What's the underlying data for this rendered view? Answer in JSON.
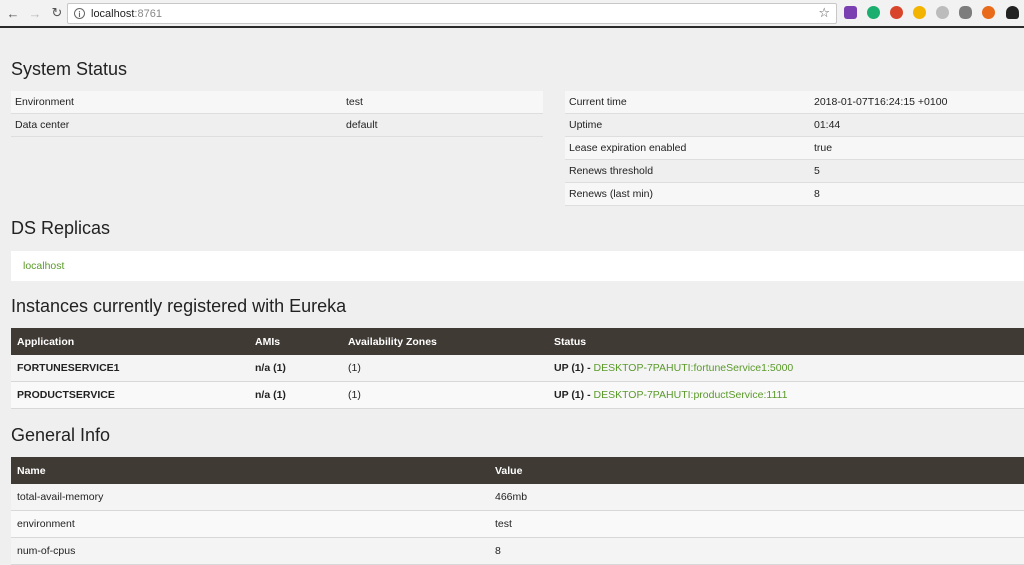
{
  "browser": {
    "back_icon": "←",
    "forward_icon": "→",
    "reload_icon": "↻",
    "url_host": "localhost",
    "url_port": ":8761",
    "star_icon": "☆"
  },
  "system_status": {
    "title": "System Status",
    "left": [
      {
        "label": "Environment",
        "value": "test"
      },
      {
        "label": "Data center",
        "value": "default"
      }
    ],
    "right": [
      {
        "label": "Current time",
        "value": "2018-01-07T16:24:15 +0100"
      },
      {
        "label": "Uptime",
        "value": "01:44"
      },
      {
        "label": "Lease expiration enabled",
        "value": "true"
      },
      {
        "label": "Renews threshold",
        "value": "5"
      },
      {
        "label": "Renews (last min)",
        "value": "8"
      }
    ]
  },
  "ds_replicas": {
    "title": "DS Replicas",
    "link": "localhost"
  },
  "instances": {
    "title": "Instances currently registered with Eureka",
    "headers": [
      "Application",
      "AMIs",
      "Availability Zones",
      "Status"
    ],
    "rows": [
      {
        "application": "FORTUNESERVICE1",
        "amis": "n/a (1)",
        "zones": "(1)",
        "status_prefix": "UP (1) - ",
        "status_link": "DESKTOP-7PAHUTI:fortuneService1:5000"
      },
      {
        "application": "PRODUCTSERVICE",
        "amis": "n/a (1)",
        "zones": "(1)",
        "status_prefix": "UP (1) - ",
        "status_link": "DESKTOP-7PAHUTI:productService:1111"
      }
    ]
  },
  "general_info": {
    "title": "General Info",
    "headers": [
      "Name",
      "Value"
    ],
    "rows": [
      {
        "name": "total-avail-memory",
        "value": "466mb"
      },
      {
        "name": "environment",
        "value": "test"
      },
      {
        "name": "num-of-cpus",
        "value": "8"
      }
    ]
  },
  "colors": {
    "header_bg": "#3f3a34",
    "link": "#5a9a2a",
    "page_bg": "#efefef"
  }
}
